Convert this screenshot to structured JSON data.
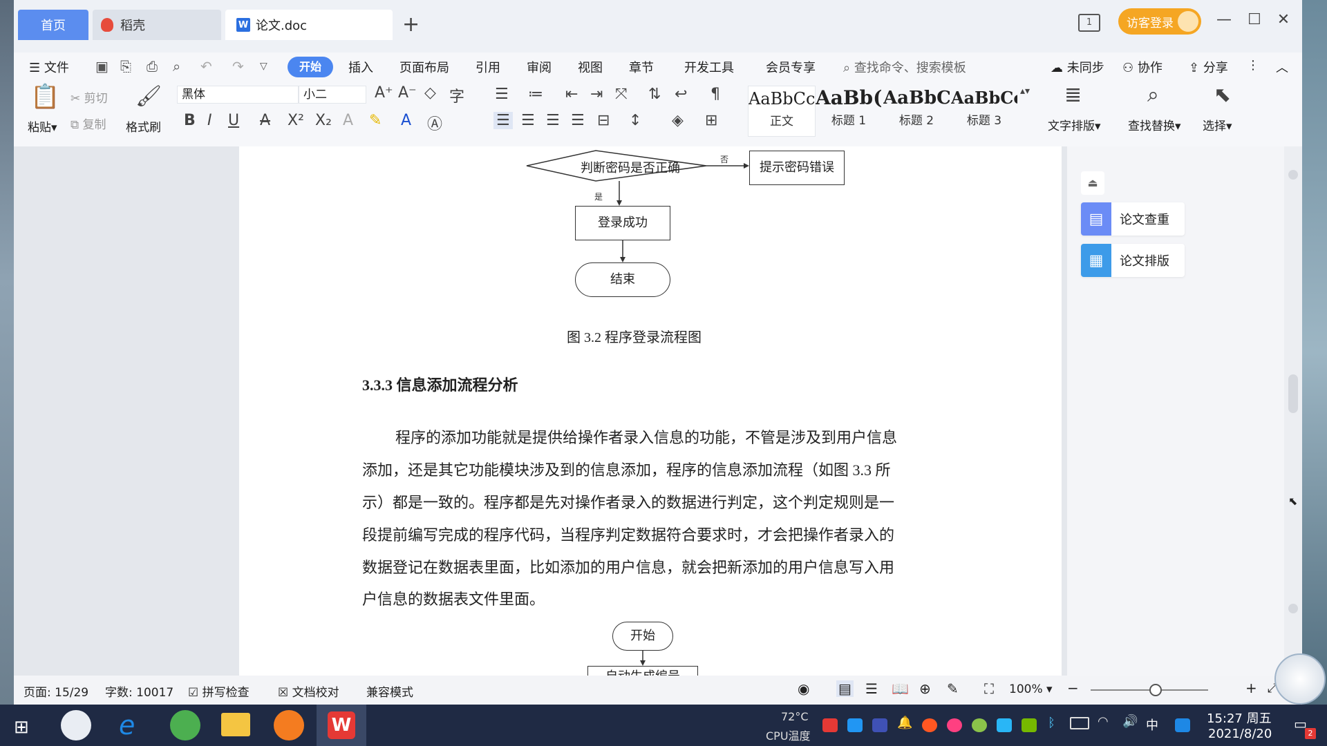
{
  "window": {
    "tabs": {
      "home": "首页",
      "daoke": "稻壳",
      "doc": "论文.doc",
      "add": "+"
    },
    "layout_icon": "1",
    "visitor_login": "访客登录",
    "controls": {
      "minimize": "—",
      "maximize": "☐",
      "close": "✕"
    }
  },
  "menu": {
    "file": "文件",
    "items": [
      "开始",
      "插入",
      "页面布局",
      "引用",
      "审阅",
      "视图",
      "章节",
      "开发工具",
      "会员专享"
    ],
    "search_placeholder": "查找命令、搜索模板",
    "right": {
      "unsynced": "未同步",
      "collab": "协作",
      "share": "分享"
    }
  },
  "ribbon": {
    "paste": "粘贴",
    "cut": "剪切",
    "copy": "复制",
    "format_painter": "格式刷",
    "font_name": "黑体",
    "font_size": "小二",
    "styles": [
      {
        "sample": "AaBbCcI",
        "label": "正文"
      },
      {
        "sample": "AaBb(",
        "label": "标题 1"
      },
      {
        "sample": "AaBbC",
        "label": "标题 2"
      },
      {
        "sample": "AaBbCcl",
        "label": "标题 3"
      }
    ],
    "text_layout": "文字排版",
    "find_replace": "查找替换",
    "select": "选择"
  },
  "document": {
    "flow1": {
      "decision": "判断密码是否正确",
      "no_label": "否",
      "yes_label": "是",
      "error": "提示密码错误",
      "success": "登录成功",
      "end": "结束"
    },
    "figure_caption": "图 3.2  程序登录流程图",
    "section_heading": "3.3.3  信息添加流程分析",
    "paragraph_lines": [
      "程序的添加功能就是提供给操作者录入信息的功能，不管是涉及到用户信息",
      "添加，还是其它功能模块涉及到的信息添加，程序的信息添加流程（如图 3.3 所",
      "示）都是一致的。程序都是先对操作者录入的数据进行判定，这个判定规则是一",
      "段提前编写完成的程序代码，当程序判定数据符合要求时，才会把操作者录入的",
      "数据登记在数据表里面，比如添加的用户信息，就会把新添加的用户信息写入用",
      "户信息的数据表文件里面。"
    ],
    "flow2": {
      "start": "开始",
      "next_partial": "自动生成编号"
    }
  },
  "side_panel": {
    "check": "论文查重",
    "layout": "论文排版"
  },
  "status": {
    "page": "页面: 15/29",
    "words": "字数: 10017",
    "spell": "拼写检查",
    "proof": "文档校对",
    "compat": "兼容模式",
    "zoom": "100%",
    "zoom_level": 0.55
  },
  "taskbar": {
    "cpu_temp": "72°C",
    "cpu_label": "CPU温度",
    "ime": "中",
    "time": "15:27 周五",
    "date": "2021/8/20",
    "notif_count": "2"
  },
  "colors": {
    "accent": "#4b86f0",
    "visitor": "#f5a623",
    "taskbar": "#1f2a44"
  }
}
